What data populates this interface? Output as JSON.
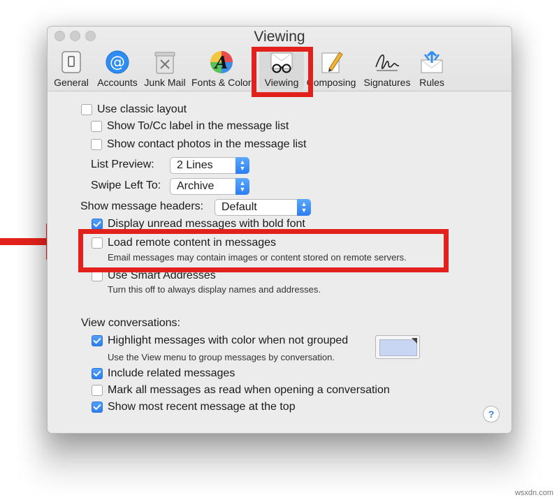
{
  "window": {
    "title": "Viewing"
  },
  "toolbar": {
    "items": [
      {
        "label": "General",
        "icon": "general-icon"
      },
      {
        "label": "Accounts",
        "icon": "at-sign-icon"
      },
      {
        "label": "Junk Mail",
        "icon": "trash-bin-icon"
      },
      {
        "label": "Fonts & Colors",
        "icon": "font-color-icon"
      },
      {
        "label": "Viewing",
        "icon": "glasses-icon",
        "selected": true
      },
      {
        "label": "Composing",
        "icon": "pencil-icon"
      },
      {
        "label": "Signatures",
        "icon": "signature-icon"
      },
      {
        "label": "Rules",
        "icon": "rules-envelope-icon"
      }
    ]
  },
  "settings": {
    "classic_layout": {
      "label": "Use classic layout",
      "checked": false
    },
    "show_tocc": {
      "label": "Show To/Cc label in the message list",
      "checked": false
    },
    "show_contact_photos": {
      "label": "Show contact photos in the message list",
      "checked": false
    },
    "list_preview": {
      "label": "List Preview:",
      "value": "2 Lines"
    },
    "swipe_left": {
      "label": "Swipe Left To:",
      "value": "Archive"
    },
    "message_headers": {
      "label": "Show message headers:",
      "value": "Default"
    },
    "bold_unread": {
      "label": "Display unread messages with bold font",
      "checked": true
    },
    "remote_content": {
      "label": "Load remote content in messages",
      "description": "Email messages may contain images or content stored on remote servers.",
      "checked": false
    },
    "smart_addresses": {
      "label": "Use Smart Addresses",
      "description": "Turn this off to always display names and addresses.",
      "checked": false
    }
  },
  "conversations": {
    "heading": "View conversations:",
    "highlight": {
      "label": "Highlight messages with color when not grouped",
      "description": "Use the View menu to group messages by conversation.",
      "checked": true,
      "color": "#c9d6f3"
    },
    "include_related": {
      "label": "Include related messages",
      "checked": true
    },
    "mark_read": {
      "label": "Mark all messages as read when opening a conversation",
      "checked": false
    },
    "most_recent_top": {
      "label": "Show most recent message at the top",
      "checked": true
    }
  },
  "help": {
    "label": "?"
  },
  "annotation": {
    "color": "#e3211c"
  },
  "watermark": "wsxdn.com"
}
